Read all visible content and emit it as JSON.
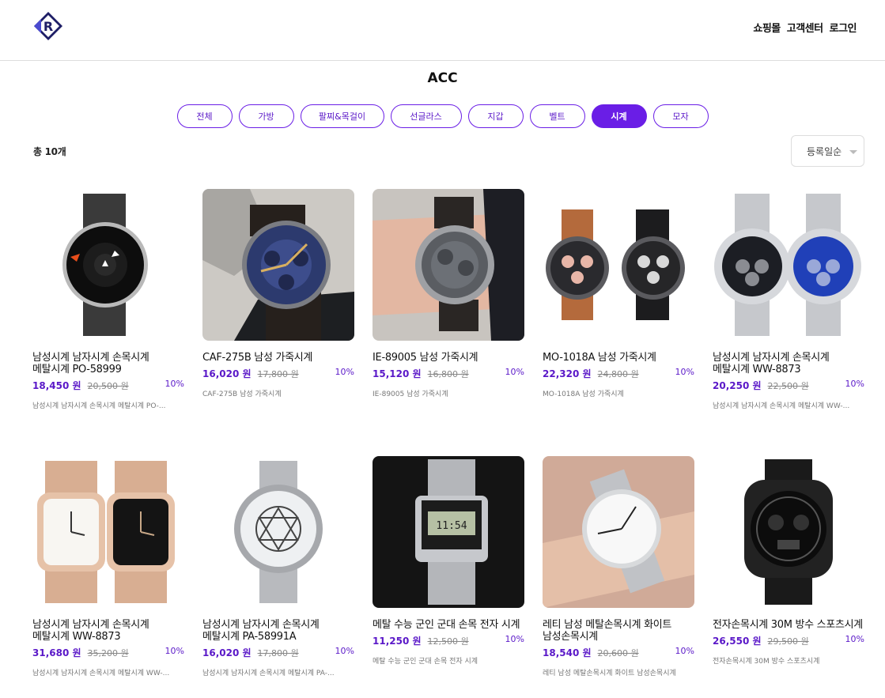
{
  "header": {
    "logo_letter": "R",
    "nav": [
      "쇼핑몰",
      "고객센터",
      "로그인"
    ]
  },
  "page_title": "ACC",
  "tabs": [
    "전체",
    "가방",
    "팔찌&목걸이",
    "선글라스",
    "지갑",
    "벨트",
    "시계",
    "모자"
  ],
  "active_tab": "시계",
  "total_count": "총 10개",
  "sort": {
    "selected": "등록일순"
  },
  "colors": {
    "accent": "#6a1ee6",
    "price": "#5a18c8"
  },
  "products": [
    {
      "name": "남성시계 남자시계 손목시계 메탈시계 PO-58999",
      "price": "18,450 원",
      "original": "20,500 원",
      "discount": "10%",
      "desc": "남성시계 남자시계 손목시계 메탈시계 PO-..."
    },
    {
      "name": "CAF-275B 남성 가죽시계",
      "price": "16,020 원",
      "original": "17,800 원",
      "discount": "10%",
      "desc": "CAF-275B 남성 가죽시계"
    },
    {
      "name": "IE-89005 남성 가죽시계",
      "price": "15,120 원",
      "original": "16,800 원",
      "discount": "10%",
      "desc": "IE-89005 남성 가죽시계"
    },
    {
      "name": "MO-1018A 남성 가죽시계",
      "price": "22,320 원",
      "original": "24,800 원",
      "discount": "10%",
      "desc": "MO-1018A 남성 가죽시계"
    },
    {
      "name": "남성시계 남자시계 손목시계 메탈시계 WW-8873",
      "price": "20,250 원",
      "original": "22,500 원",
      "discount": "10%",
      "desc": "남성시계 남자시계 손목시계 메탈시계 WW-..."
    },
    {
      "name": "남성시계 남자시계 손목시계 메탈시계 WW-8873",
      "price": "31,680 원",
      "original": "35,200 원",
      "discount": "10%",
      "desc": "남성시계 남자시계 손목시계 메탈시계 WW-..."
    },
    {
      "name": "남성시계 남자시계 손목시계 메탈시계 PA-58991A",
      "price": "16,020 원",
      "original": "17,800 원",
      "discount": "10%",
      "desc": "남성시계 남자시계 손목시계 메탈시계 PA-..."
    },
    {
      "name": "메탈 수능 군인 군대 손목 전자 시계",
      "price": "11,250 원",
      "original": "12,500 원",
      "discount": "10%",
      "desc": "메탈 수능 군인 군대 손목 전자 시계"
    },
    {
      "name": "레티 남성 메탈손목시계 화이트 남성손목시계",
      "price": "18,540 원",
      "original": "20,600 원",
      "discount": "10%",
      "desc": "레티 남성 메탈손목시계 화이트 남성손목시계"
    },
    {
      "name": "전자손목시계 30M 방수 스포츠시계",
      "price": "26,550 원",
      "original": "29,500 원",
      "discount": "10%",
      "desc": "전자손목시계 30M 방수 스포츠시계"
    }
  ]
}
